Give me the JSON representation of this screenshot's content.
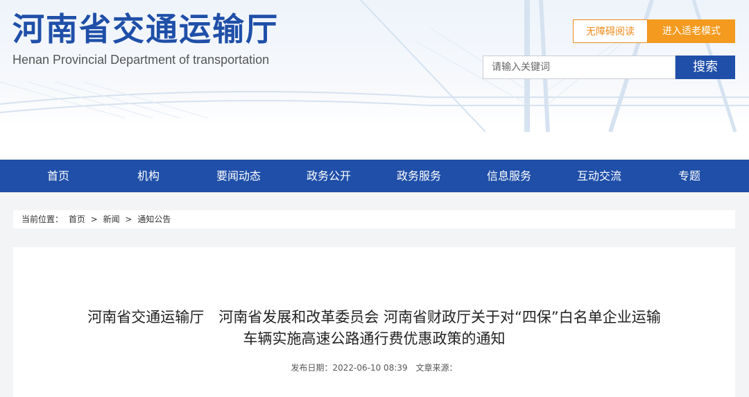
{
  "header": {
    "title_cn": "河南省交通运输厅",
    "title_en": "Henan Provincial Department of transportation",
    "accessibility_button": "无障碍阅读",
    "elder_mode_button": "进入适老模式",
    "search": {
      "placeholder": "请输入关键词",
      "button_label": "搜索"
    }
  },
  "nav": {
    "items": [
      {
        "label": "首页"
      },
      {
        "label": "机构"
      },
      {
        "label": "要闻动态"
      },
      {
        "label": "政务公开"
      },
      {
        "label": "政务服务"
      },
      {
        "label": "信息服务"
      },
      {
        "label": "互动交流"
      },
      {
        "label": "专题"
      }
    ]
  },
  "breadcrumb": {
    "prefix": "当前位置：",
    "items": [
      "首页",
      ">",
      "新闻",
      ">",
      "通知公告"
    ]
  },
  "article": {
    "title_line1": "河南省交通运输厅　河南省发展和改革委员会 河南省财政厅关于对“四保”白名单企业运输",
    "title_line2": "车辆实施高速公路通行费优惠政策的通知",
    "publish_label": "发布日期：2022-06-10 08:39",
    "source_label": "文章来源："
  },
  "colors": {
    "brand_blue": "#1f4fa8",
    "accent_orange": "#f39a1f"
  }
}
